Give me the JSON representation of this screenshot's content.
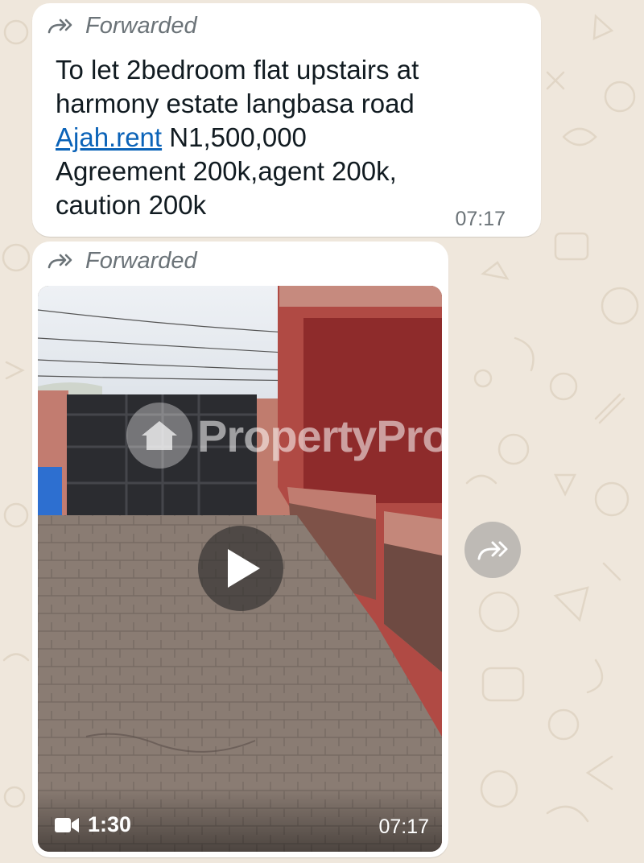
{
  "colors": {
    "wallpaper": "#efe7dc",
    "bubble": "#ffffff",
    "link": "#0b63b8",
    "meta_text": "#6b7378"
  },
  "message1": {
    "forwarded_label": "Forwarded",
    "forward_icon": "double-arrow-forward-icon",
    "text_line1": "To let 2bedroom flat upstairs at",
    "text_line2": "harmony estate langbasa road",
    "link_text": "Ajah.rent",
    "text_line3_rest": " N1,500,000",
    "text_line4": "Agreement 200k,agent 200k,",
    "text_line5": "caution 200k",
    "time": "07:17"
  },
  "message2": {
    "forwarded_label": "Forwarded",
    "forward_icon": "double-arrow-forward-icon",
    "video": {
      "watermark": "PropertyPro",
      "play_icon": "play-icon",
      "duration_icon": "video-camera-icon",
      "duration": "1:30",
      "time": "07:17"
    }
  },
  "share_button": {
    "icon": "forward-share-icon"
  }
}
